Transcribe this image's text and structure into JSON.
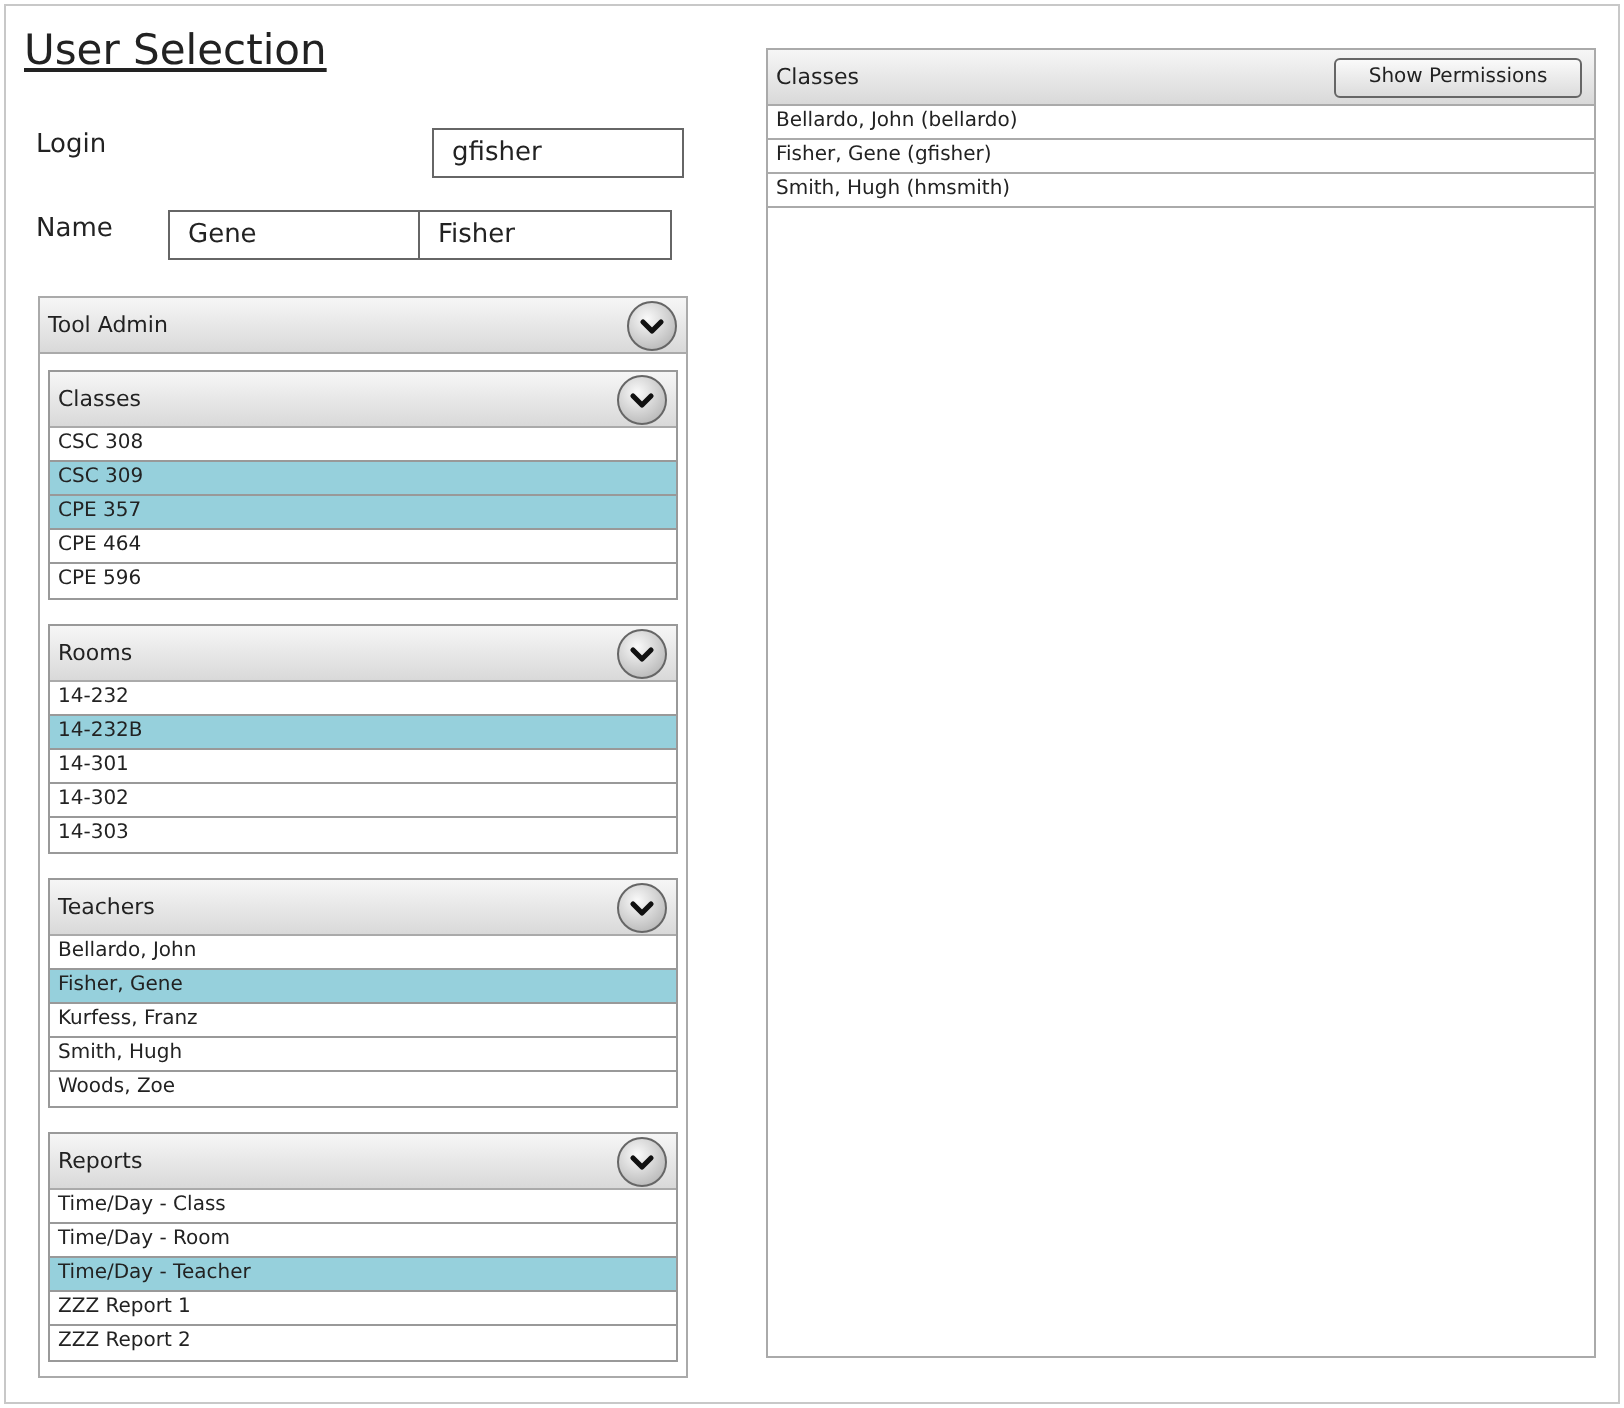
{
  "title": "User Selection",
  "login": {
    "label": "Login",
    "value": "gfisher"
  },
  "name": {
    "label": "Name",
    "first": "Gene",
    "last": "Fisher"
  },
  "tool_admin": {
    "title": "Tool Admin",
    "sections": [
      {
        "title": "Classes",
        "items": [
          {
            "label": "CSC 308",
            "selected": false
          },
          {
            "label": "CSC 309",
            "selected": true
          },
          {
            "label": "CPE 357",
            "selected": true
          },
          {
            "label": "CPE 464",
            "selected": false
          },
          {
            "label": "CPE 596",
            "selected": false
          }
        ]
      },
      {
        "title": "Rooms",
        "items": [
          {
            "label": "14-232",
            "selected": false
          },
          {
            "label": "14-232B",
            "selected": true
          },
          {
            "label": "14-301",
            "selected": false
          },
          {
            "label": "14-302",
            "selected": false
          },
          {
            "label": "14-303",
            "selected": false
          }
        ]
      },
      {
        "title": "Teachers",
        "items": [
          {
            "label": "Bellardo, John",
            "selected": false
          },
          {
            "label": "Fisher, Gene",
            "selected": true
          },
          {
            "label": "Kurfess, Franz",
            "selected": false
          },
          {
            "label": "Smith, Hugh",
            "selected": false
          },
          {
            "label": "Woods, Zoe",
            "selected": false
          }
        ]
      },
      {
        "title": "Reports",
        "items": [
          {
            "label": "Time/Day - Class",
            "selected": false
          },
          {
            "label": "Time/Day - Room",
            "selected": false
          },
          {
            "label": "Time/Day - Teacher",
            "selected": true
          },
          {
            "label": "ZZZ Report 1",
            "selected": false
          },
          {
            "label": "ZZZ Report 2",
            "selected": false
          }
        ]
      }
    ]
  },
  "users_panel": {
    "title": "Classes",
    "button": "Show Permissions",
    "rows": [
      "Bellardo, John (bellardo)",
      "Fisher, Gene (gfisher)",
      "Smith, Hugh (hmsmith)"
    ]
  }
}
